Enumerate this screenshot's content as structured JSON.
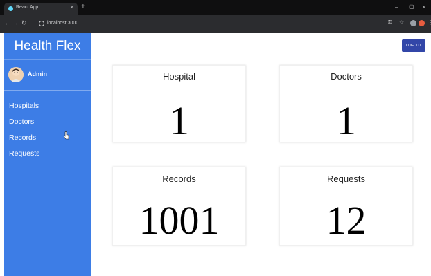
{
  "browser": {
    "tab_title": "React App",
    "new_tab_icon": "+",
    "tab_close_icon": "×",
    "minimize_icon": "–",
    "maximize_icon": "▢",
    "close_icon": "×",
    "url": "localhost:3000"
  },
  "sidebar": {
    "brand": "Health Flex",
    "user_name": "Admin",
    "items": [
      {
        "label": "Hospitals"
      },
      {
        "label": "Doctors"
      },
      {
        "label": "Records"
      },
      {
        "label": "Requests"
      }
    ]
  },
  "topbar": {
    "logout_label": "LOGOUT"
  },
  "cards": [
    {
      "title": "Hospital",
      "value": "1"
    },
    {
      "title": "Doctors",
      "value": "1"
    },
    {
      "title": "Records",
      "value": "1001"
    },
    {
      "title": "Requests",
      "value": "12"
    }
  ],
  "colors": {
    "sidebar": "#3d7de6",
    "logout_button": "#3246a8",
    "browser_chrome": "#202124"
  }
}
